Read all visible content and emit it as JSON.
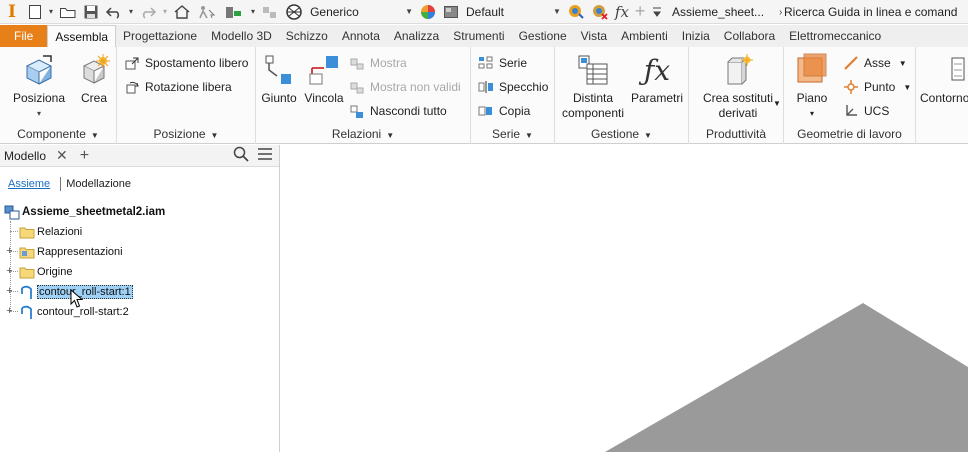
{
  "qat": {
    "app_logo": "I",
    "appearance_select": "Generico",
    "material_select": "Default",
    "fx_label": "fx",
    "doc_title": "Assieme_sheet...",
    "search_text": "Ricerca Guida in linea e comand"
  },
  "tabs": [
    "File",
    "Assembla",
    "Progettazione",
    "Modello 3D",
    "Schizzo",
    "Annota",
    "Analizza",
    "Strumenti",
    "Gestione",
    "Vista",
    "Ambienti",
    "Inizia",
    "Collabora",
    "Elettromeccanico"
  ],
  "ribbon": {
    "componente": {
      "title": "Componente",
      "posiziona": "Posiziona",
      "crea": "Crea"
    },
    "posizione": {
      "title": "Posizione",
      "spostamento_libero": "Spostamento libero",
      "rotazione_libera": "Rotazione libera"
    },
    "relazioni": {
      "title": "Relazioni",
      "giunto": "Giunto",
      "vincola": "Vincola",
      "mostra": "Mostra",
      "mostra_non_validi": "Mostra non validi",
      "nascondi_tutto": "Nascondi tutto"
    },
    "serie": {
      "title": "Serie",
      "serie": "Serie",
      "specchio": "Specchio",
      "copia": "Copia"
    },
    "gestione": {
      "title": "Gestione",
      "distinta_1": "Distinta",
      "distinta_2": "componenti",
      "parametri": "Parametri"
    },
    "produttivita": {
      "title": "Produttività",
      "crea_sostituti_1": "Crea sostituti",
      "crea_sostituti_2": "derivati"
    },
    "geometrie": {
      "title": "Geometrie di lavoro",
      "piano": "Piano",
      "asse": "Asse",
      "punto": "Punto",
      "ucs": "UCS"
    },
    "contorno": {
      "label": "Contorno"
    }
  },
  "browser": {
    "title": "Modello",
    "subtab_assieme": "Assieme",
    "subtab_modellazione": "Modellazione",
    "root": "Assieme_sheetmetal2.iam",
    "nodes": [
      "Relazioni",
      "Rappresentazioni",
      "Origine",
      "contour_roll-start:1",
      "contour_roll-start:2"
    ]
  },
  "colors": {
    "file_tab": "#e8801a",
    "selection": "#9fd0f5",
    "model_gray": "#9a9a9a"
  }
}
